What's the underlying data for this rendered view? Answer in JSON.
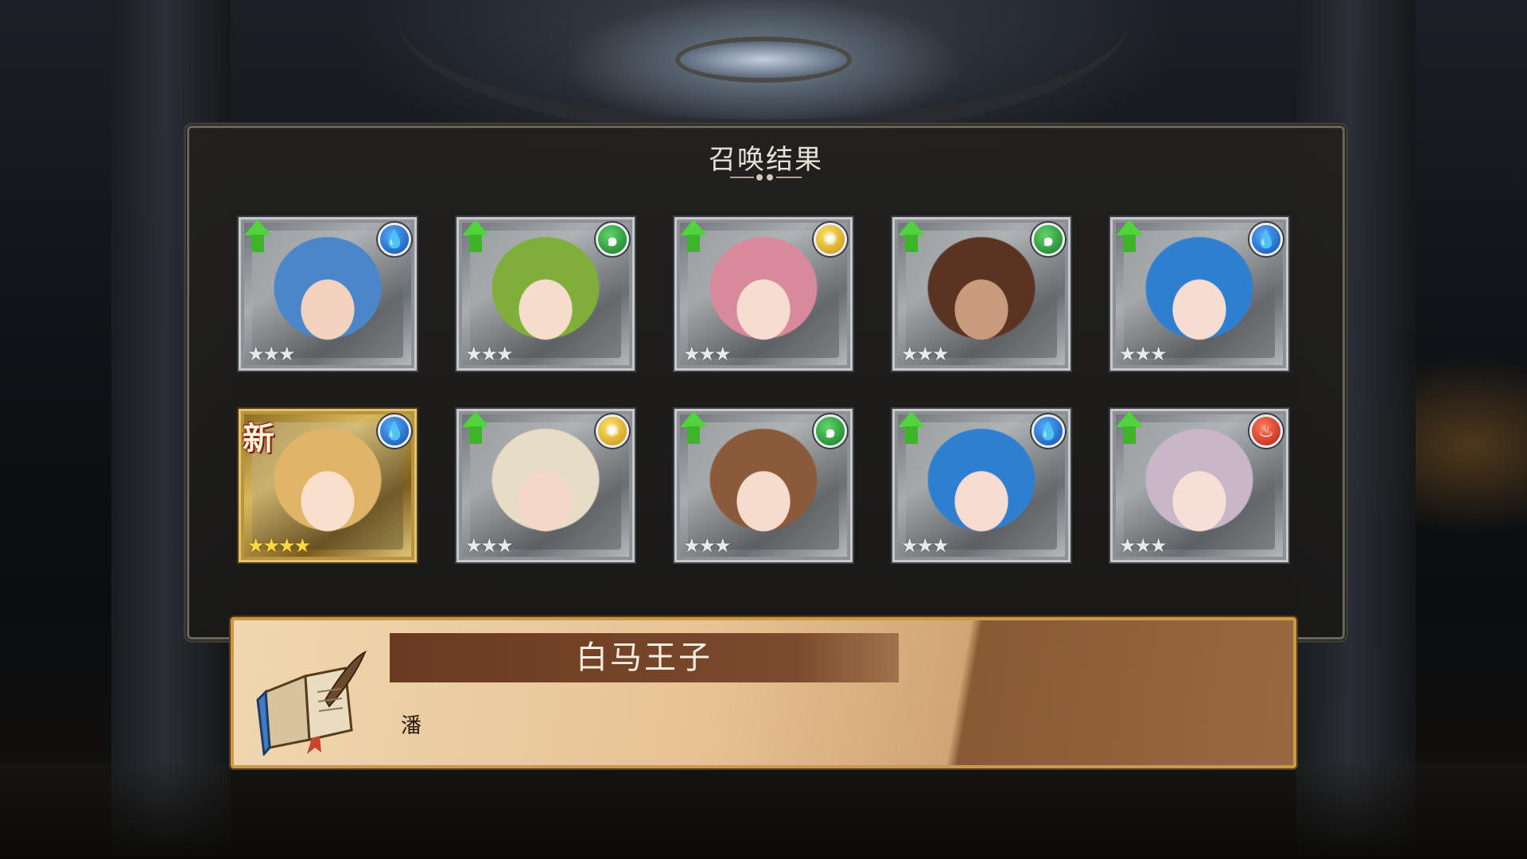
{
  "panel": {
    "title": "召唤结果"
  },
  "cards": [
    {
      "element": "water",
      "element_icon": "water-drop-icon",
      "stars": "★★★",
      "upgrade": true,
      "is_new": false,
      "gold": false,
      "hair": "#4a86c9",
      "skin": "#f3d2c0"
    },
    {
      "element": "wind",
      "element_icon": "wind-swirl-icon",
      "stars": "★★★",
      "upgrade": true,
      "is_new": false,
      "gold": false,
      "hair": "#7fae3a",
      "skin": "#f6dccb"
    },
    {
      "element": "light",
      "element_icon": "sun-icon",
      "stars": "★★★",
      "upgrade": true,
      "is_new": false,
      "gold": false,
      "hair": "#d88a9c",
      "skin": "#f7ddd0"
    },
    {
      "element": "wind",
      "element_icon": "wind-swirl-icon",
      "stars": "★★★",
      "upgrade": true,
      "is_new": false,
      "gold": false,
      "hair": "#5a3322",
      "skin": "#c99a7c"
    },
    {
      "element": "water",
      "element_icon": "water-drop-icon",
      "stars": "★★★",
      "upgrade": true,
      "is_new": false,
      "gold": false,
      "hair": "#2f7fd0",
      "skin": "#f7dcd2"
    },
    {
      "element": "water",
      "element_icon": "water-drop-icon",
      "stars": "★★★★",
      "upgrade": false,
      "is_new": true,
      "new_label": "新",
      "gold": true,
      "hair": "#e0b56a",
      "skin": "#f8e0cd"
    },
    {
      "element": "light",
      "element_icon": "sun-icon",
      "stars": "★★★",
      "upgrade": true,
      "is_new": false,
      "gold": false,
      "hair": "#e7dcc6",
      "skin": "#f4d7c4"
    },
    {
      "element": "wind",
      "element_icon": "wind-swirl-icon",
      "stars": "★★★",
      "upgrade": true,
      "is_new": false,
      "gold": false,
      "hair": "#8a5a3a",
      "skin": "#f6dccd"
    },
    {
      "element": "water",
      "element_icon": "water-drop-icon",
      "stars": "★★★",
      "upgrade": true,
      "is_new": false,
      "gold": false,
      "hair": "#2f7fd0",
      "skin": "#f7dcd2"
    },
    {
      "element": "fire",
      "element_icon": "flame-icon",
      "stars": "★★★",
      "upgrade": true,
      "is_new": false,
      "gold": false,
      "hair": "#c9b7c9",
      "skin": "#f6dfd6"
    }
  ],
  "banner": {
    "name": "白马王子",
    "subtitle": "潘"
  },
  "colors": {
    "water": "#1f6fd0",
    "wind": "#22a33a",
    "light": "#e4b21a",
    "fire": "#d8351d",
    "upgrade_arrow": "#4fd43c"
  }
}
